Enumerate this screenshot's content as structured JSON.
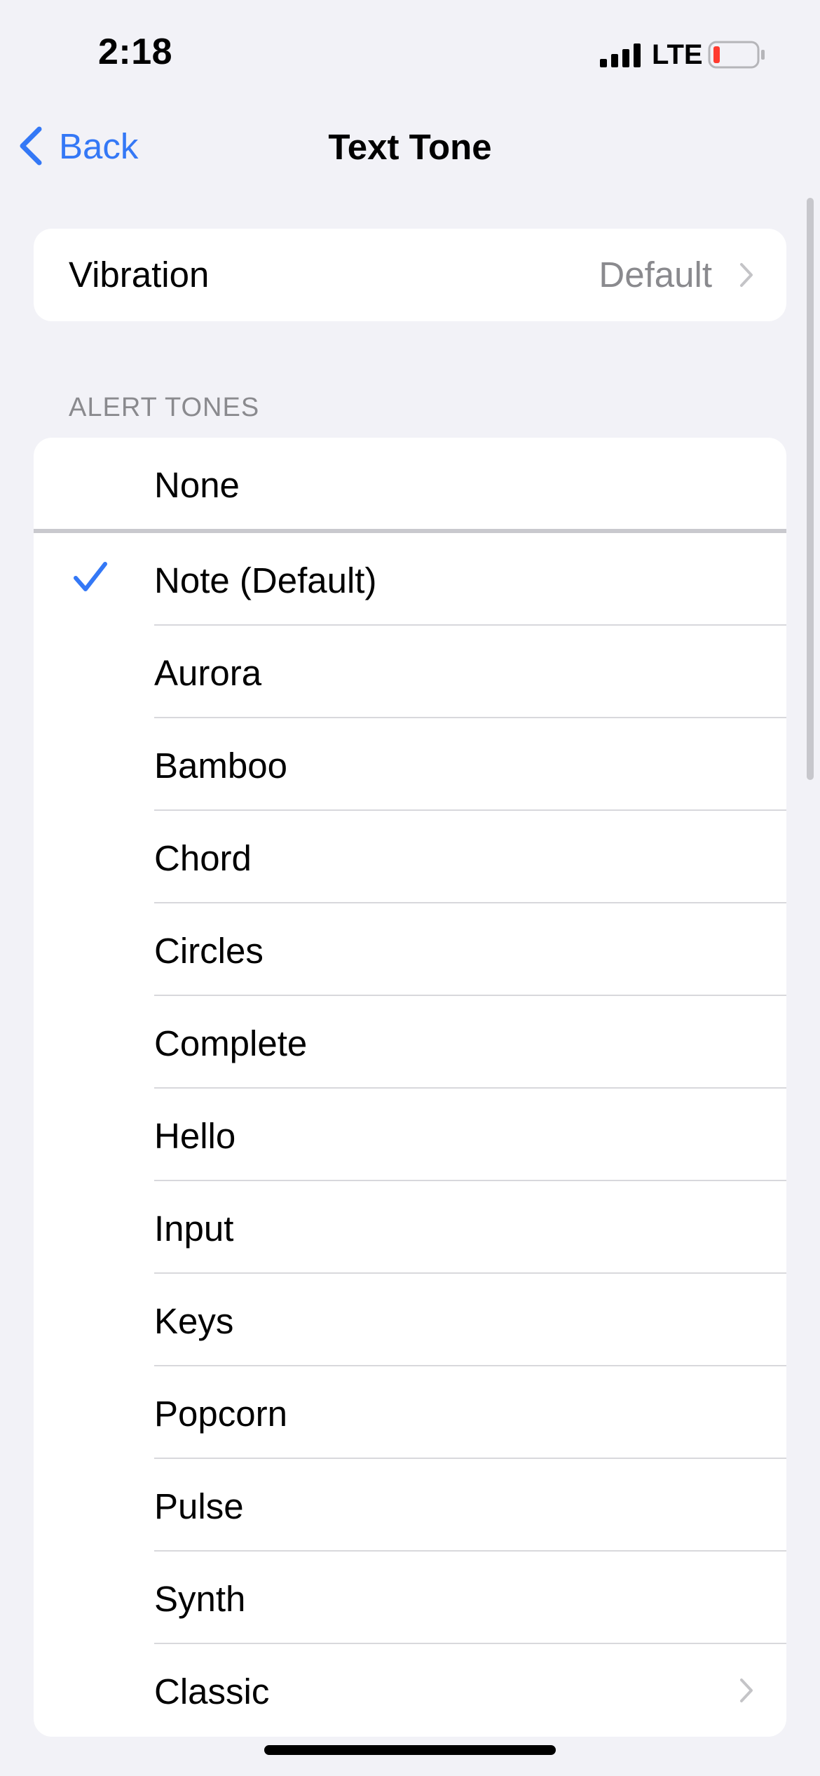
{
  "status_bar": {
    "time": "2:18",
    "network": "LTE",
    "signal_icon": "cellular-signal-icon",
    "battery_icon": "battery-low-icon",
    "battery_color": "#ff3b30"
  },
  "nav": {
    "back_label": "Back",
    "back_icon": "chevron-left-icon",
    "title": "Text Tone",
    "accent_color": "#3478f6"
  },
  "vibration": {
    "label": "Vibration",
    "value": "Default",
    "icon": "chevron-right-icon"
  },
  "alert_tones": {
    "header": "ALERT TONES",
    "selected": "Note (Default)",
    "items": [
      {
        "label": "None"
      },
      {
        "label": "Note (Default)",
        "checked": true
      },
      {
        "label": "Aurora"
      },
      {
        "label": "Bamboo"
      },
      {
        "label": "Chord"
      },
      {
        "label": "Circles"
      },
      {
        "label": "Complete"
      },
      {
        "label": "Hello"
      },
      {
        "label": "Input"
      },
      {
        "label": "Keys"
      },
      {
        "label": "Popcorn"
      },
      {
        "label": "Pulse"
      },
      {
        "label": "Synth"
      },
      {
        "label": "Classic",
        "has_disclosure": true
      }
    ]
  }
}
